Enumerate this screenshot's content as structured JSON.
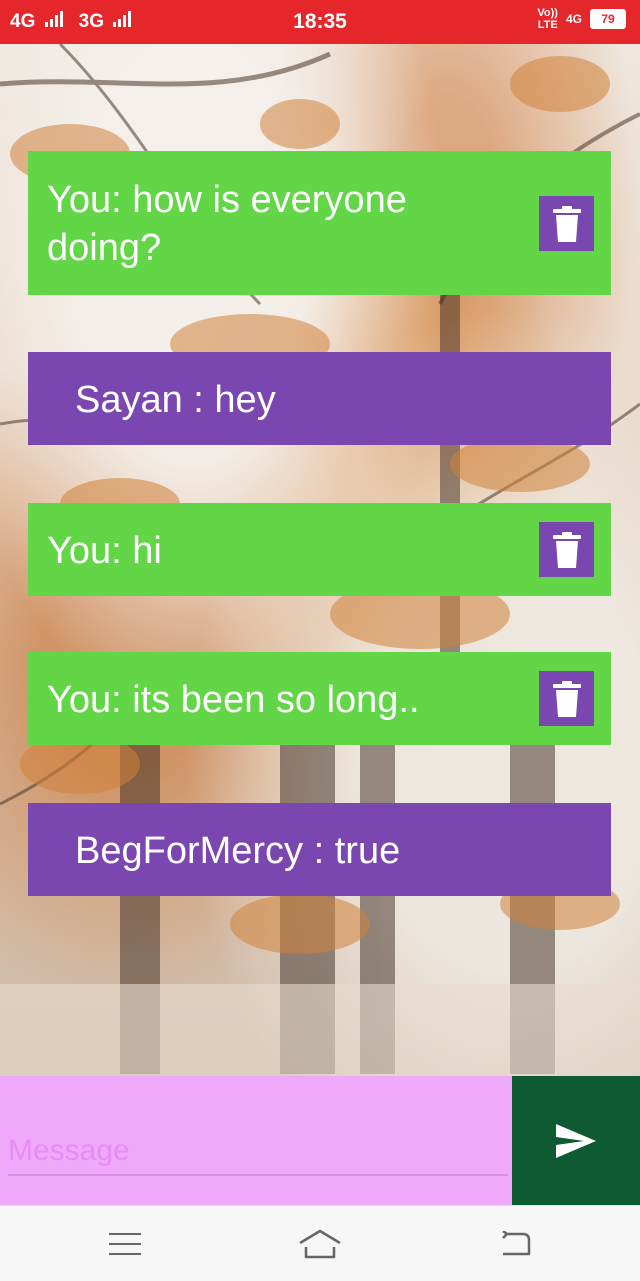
{
  "status_bar": {
    "network_1": "4G",
    "network_2": "3G",
    "time": "18:35",
    "volte_top": "Vo))",
    "volte_bottom": "LTE",
    "net_small": "4G",
    "battery": "79"
  },
  "messages": [
    {
      "sender": "self",
      "text": "You: how is everyone doing?",
      "line1": "You: how is everyone",
      "line2": "doing?",
      "deletable": true
    },
    {
      "sender": "other",
      "text": "Sayan : hey",
      "deletable": false
    },
    {
      "sender": "self",
      "text": "You: hi",
      "deletable": true
    },
    {
      "sender": "self",
      "text": "You: its been so long..",
      "deletable": true
    },
    {
      "sender": "other",
      "text": "BegForMercy : true",
      "deletable": false
    }
  ],
  "composer": {
    "placeholder": "Message",
    "value": ""
  },
  "icons": {
    "delete": "trash-icon",
    "send": "send-icon",
    "nav_menu": "menu-icon",
    "nav_home": "home-icon",
    "nav_back": "back-icon"
  },
  "colors": {
    "status_bar": "#e5262b",
    "self_bubble": "#63d647",
    "other_bubble": "#7a47b0",
    "input_bg": "#f0a8fb",
    "send_bg": "#0d5a33"
  }
}
